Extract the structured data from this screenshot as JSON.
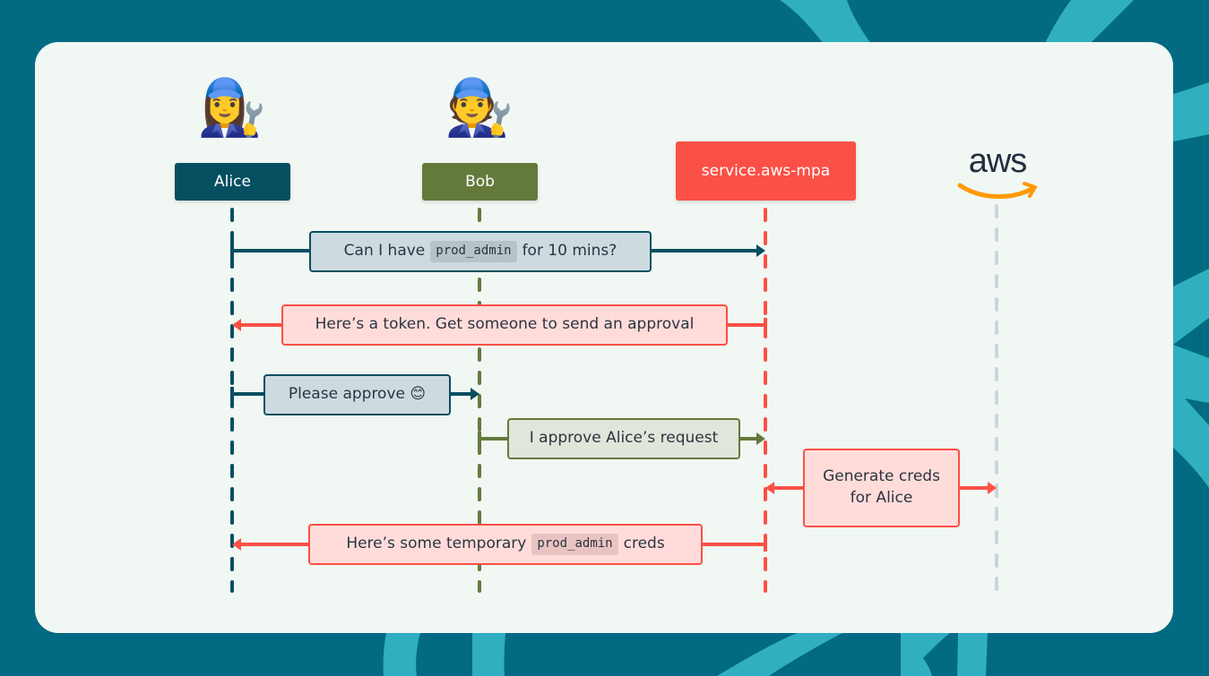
{
  "actors": [
    {
      "id": "alice",
      "label": "Alice",
      "emoji": "👩‍🔧",
      "color": "#064f60"
    },
    {
      "id": "bob",
      "label": "Bob",
      "emoji": "🧑‍🔧",
      "color": "#647a3c"
    },
    {
      "id": "mpa",
      "label": "service.aws-mpa",
      "emoji": "",
      "color": "#fb5045"
    },
    {
      "id": "aws",
      "label": "aws",
      "emoji": "",
      "color": "#c9d5de",
      "logo": true
    }
  ],
  "messages": [
    {
      "from": "alice",
      "to": "mpa",
      "parts": [
        {
          "text": "Can I have "
        },
        {
          "code": "prod_admin"
        },
        {
          "text": " for 10 mins?"
        }
      ],
      "style": "blue"
    },
    {
      "from": "mpa",
      "to": "alice",
      "parts": [
        {
          "text": "Here’s a token. Get someone to send an approval"
        }
      ],
      "style": "red"
    },
    {
      "from": "alice",
      "to": "bob",
      "parts": [
        {
          "text": "Please approve 😊"
        }
      ],
      "style": "blue"
    },
    {
      "from": "bob",
      "to": "mpa",
      "parts": [
        {
          "text": "I approve Alice’s request"
        }
      ],
      "style": "green"
    },
    {
      "from": "mpa",
      "to": "aws",
      "bidirectional": true,
      "parts": [
        {
          "text": "Generate creds"
        },
        {
          "br": true
        },
        {
          "text": "for Alice"
        }
      ],
      "style": "red"
    },
    {
      "from": "mpa",
      "to": "alice",
      "parts": [
        {
          "text": "Here’s some temporary "
        },
        {
          "code": "prod_admin"
        },
        {
          "text": " creds"
        }
      ],
      "style": "red"
    }
  ],
  "colors": {
    "background": "#026a82",
    "background_accent": "#2fafbf",
    "card": "#f1f7f3",
    "aws_smile": "#ff9900",
    "aws_text": "#232f3e"
  }
}
